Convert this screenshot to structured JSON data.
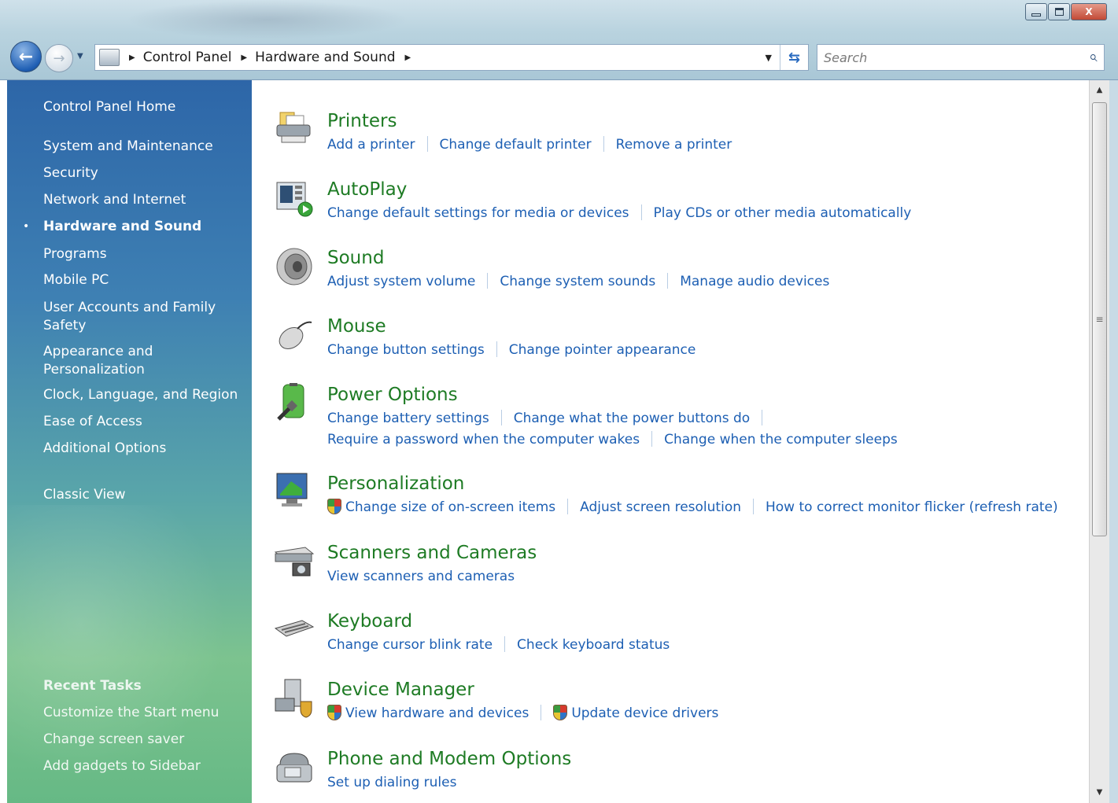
{
  "window": {
    "controls": {
      "minimize": "minimize",
      "maximize": "maximize",
      "close": "X"
    }
  },
  "nav": {
    "breadcrumbs": [
      "Control Panel",
      "Hardware and Sound"
    ],
    "search_placeholder": "Search",
    "icons": {
      "back": "back-arrow-icon",
      "forward": "forward-arrow-icon",
      "refresh": "refresh-icon",
      "search": "magnifier-icon"
    }
  },
  "sidebar": {
    "home": "Control Panel Home",
    "items": [
      "System and Maintenance",
      "Security",
      "Network and Internet",
      "Hardware and Sound",
      "Programs",
      "Mobile PC",
      "User Accounts and Family Safety",
      "Appearance and Personalization",
      "Clock, Language, and Region",
      "Ease of Access",
      "Additional Options"
    ],
    "active_item": "Hardware and Sound",
    "classic_view": "Classic View",
    "recent_tasks_heading": "Recent Tasks",
    "recent_tasks": [
      "Customize the Start menu",
      "Change screen saver",
      "Add gadgets to Sidebar"
    ]
  },
  "categories": [
    {
      "title": "Printers",
      "icon": "printer-icon",
      "links": [
        "Add a printer",
        "Change default printer",
        "Remove a printer"
      ]
    },
    {
      "title": "AutoPlay",
      "icon": "autoplay-icon",
      "links": [
        "Change default settings for media or devices",
        "Play CDs or other media automatically"
      ]
    },
    {
      "title": "Sound",
      "icon": "speaker-icon",
      "links": [
        "Adjust system volume",
        "Change system sounds",
        "Manage audio devices"
      ]
    },
    {
      "title": "Mouse",
      "icon": "mouse-icon",
      "links": [
        "Change button settings",
        "Change pointer appearance"
      ]
    },
    {
      "title": "Power Options",
      "icon": "battery-icon",
      "links": [
        "Change battery settings",
        "Change what the power buttons do"
      ],
      "links2": [
        "Require a password when the computer wakes",
        "Change when the computer sleeps"
      ]
    },
    {
      "title": "Personalization",
      "icon": "monitor-icon",
      "links": [
        "Change size of on-screen items",
        "Adjust screen resolution",
        "How to correct monitor flicker (refresh rate)"
      ]
    },
    {
      "title": "Scanners and Cameras",
      "icon": "scanner-icon",
      "links": [
        "View scanners and cameras"
      ]
    },
    {
      "title": "Keyboard",
      "icon": "keyboard-icon",
      "links": [
        "Change cursor blink rate",
        "Check keyboard status"
      ]
    },
    {
      "title": "Device Manager",
      "icon": "device-manager-icon",
      "links": [
        "View hardware and devices",
        "Update device drivers"
      ]
    },
    {
      "title": "Phone and Modem Options",
      "icon": "phone-icon",
      "links": [
        "Set up dialing rules"
      ]
    }
  ]
}
